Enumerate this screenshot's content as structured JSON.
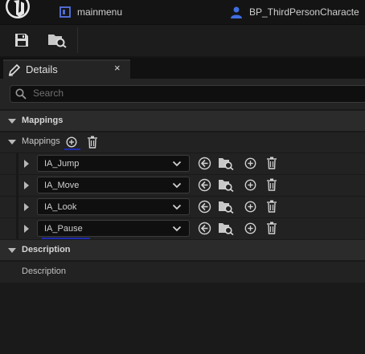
{
  "titlebar": {
    "document_tab": "mainmenu",
    "blueprint_tab": "BP_ThirdPersonCharacte"
  },
  "panel": {
    "tab_title": "Details",
    "close_glyph": "×",
    "search_placeholder": "Search"
  },
  "categories": {
    "mappings": "Mappings",
    "description": "Description"
  },
  "mappings_property": {
    "label": "Mappings"
  },
  "mapping_items": [
    {
      "action": "IA_Jump"
    },
    {
      "action": "IA_Move"
    },
    {
      "action": "IA_Look"
    },
    {
      "action": "IA_Pause"
    }
  ],
  "description_property": {
    "label": "Description"
  },
  "icons": {
    "logo": "unreal-logo-icon",
    "level": "level-icon",
    "blueprint": "person-icon",
    "save": "save-icon",
    "browse": "browse-folder-icon",
    "edit": "pencil-icon",
    "add": "plus-circle-icon",
    "delete": "trash-icon",
    "use_selected": "arrow-left-circle-icon",
    "find": "browse-folder-icon"
  },
  "colors": {
    "focus_underline": "#1f2bb0",
    "blueprint_icon": "#3f6ee0",
    "level_icon": "#4f6ad0"
  }
}
